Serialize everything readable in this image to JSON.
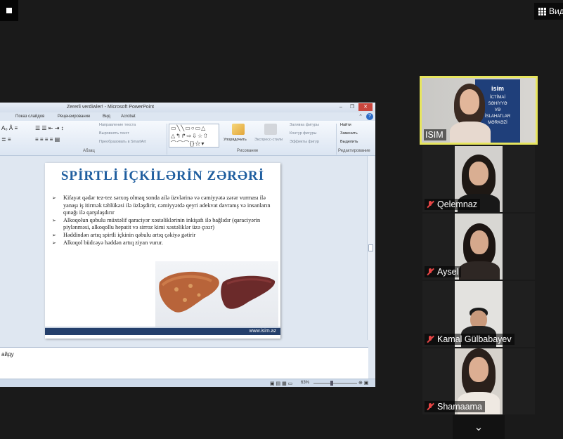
{
  "controls": {
    "view_label": "Вид"
  },
  "ppt": {
    "window_title": "Zererli verdiwler! - Microsoft PowerPoint",
    "tabs": [
      "Показ слайдов",
      "Рецензирование",
      "Вид",
      "Acrobat"
    ],
    "ribbon": {
      "paragraph_items": [
        "Направление текста",
        "Выровнять текст",
        "Преобразовать в SmartArt"
      ],
      "paragraph_label": "Абзац",
      "arrange_label": "Упорядочить",
      "quick_styles_label": "Экспресс-стили",
      "shape_items": [
        "Заливка фигуры",
        "Контур фигуры",
        "Эффекты фигур"
      ],
      "drawing_label": "Рисование",
      "edit_items": [
        "Найти",
        "Заменить",
        "Выделить"
      ],
      "editing_label": "Редактирование"
    },
    "slide": {
      "title": "SPİRTLİ İÇKİLƏRİN ZƏRƏRİ",
      "bullets": [
        "Kifayət qədər tez-tez sərxoş olmaq sonda ailə üzvlərinə və cəmiyyətə zərər vurması ilə yanaşı iş itirmək təhlükəsi ilə üzləşdirir, cəmiyyətdə qeyri adekvat davranış və insanların qınağı ilə qarşılaşdırır",
        "Alkoqolun qəbulu müxtəlif qaraciyər xəstəliklərinin inkişafı ilə bağlıdır (qaraciyərin piylənməsi, alkoqollu hepatit və sirroz kimi xəstəliklər üzə çıxır)",
        "Həddindən artıq spirtli içkinin qəbulu artıq çəkiyə gətirir",
        " Alkoqol büdcəyə həddən artıq ziyan vurur."
      ],
      "footer_url": "www.isim.az"
    },
    "notes_text": "айду",
    "zoom": "63%"
  },
  "participants": [
    {
      "name": "ISIM",
      "muted": false,
      "active": true
    },
    {
      "name": "Qelemnaz",
      "muted": true
    },
    {
      "name": "Aysel",
      "muted": true
    },
    {
      "name": "Kamal Gülbabayev",
      "muted": true
    },
    {
      "name": "Shamaama",
      "muted": true
    }
  ],
  "isim_banner": [
    "İCTİMAİ",
    "SƏHİYYƏ",
    "VƏ",
    "İSLAHATLAR",
    "MƏRKƏZİ"
  ],
  "isim_logo": "isim",
  "colors": {
    "active_speaker_border": "#e7e55e",
    "muted_mic": "#e64545",
    "slide_title": "#1f5e9f",
    "slide_footer": "#243f6b"
  }
}
